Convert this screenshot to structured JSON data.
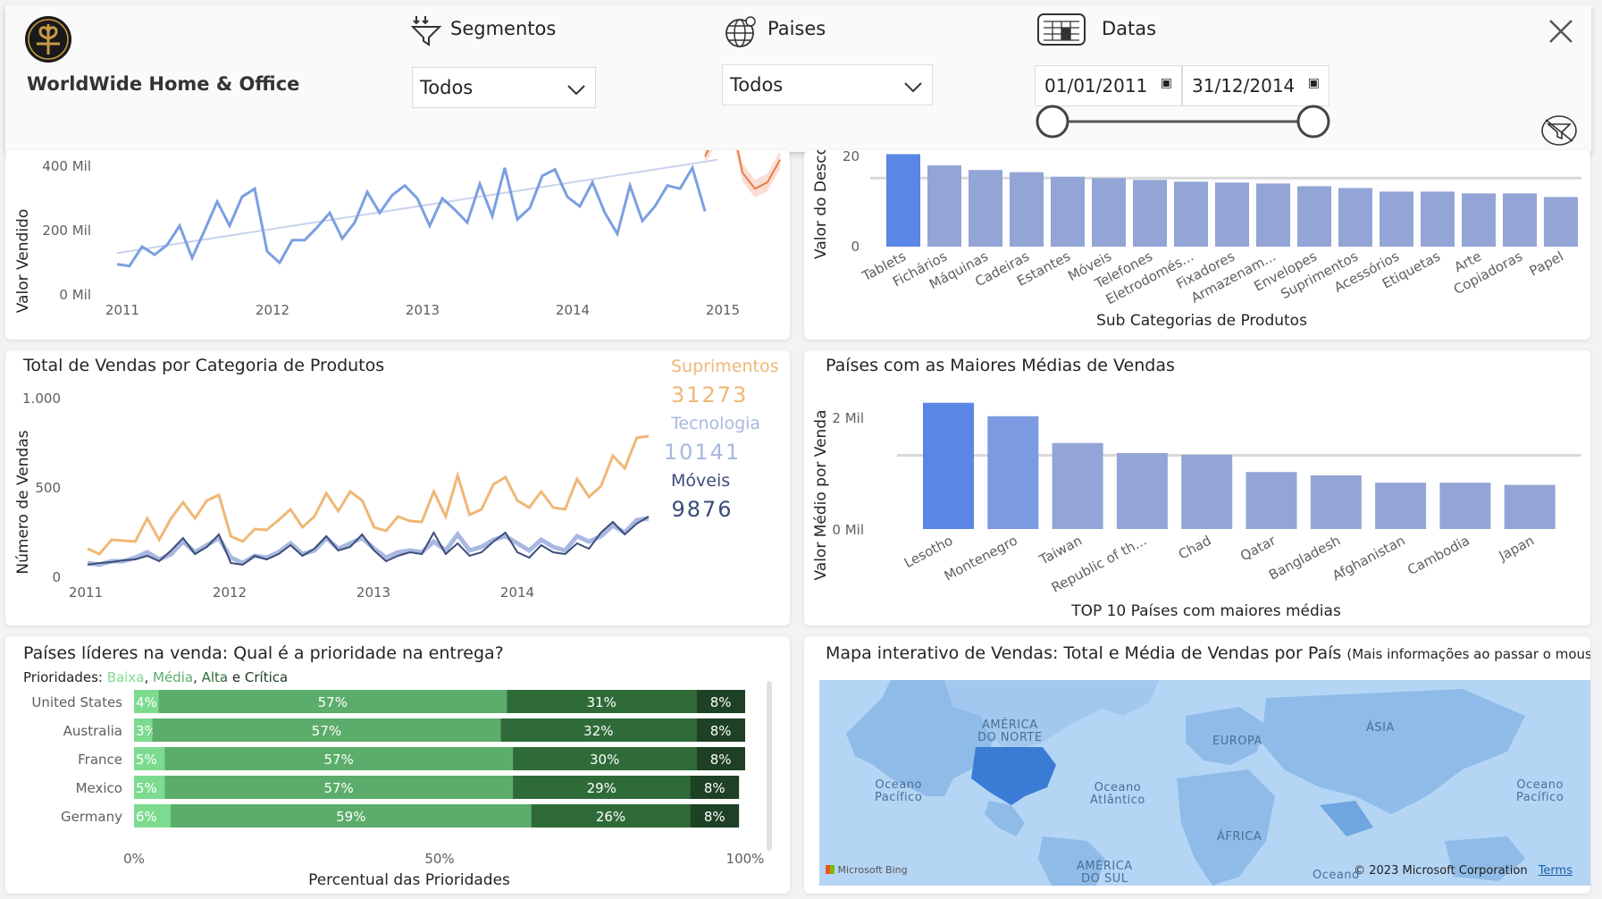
{
  "header": {
    "brand": "WorldWide Home & Office",
    "segment_label": "Segmentos",
    "segment_value": "Todos",
    "country_label": "Paises",
    "country_value": "Todos",
    "dates_label": "Datas",
    "date_start": "01/01/2011",
    "date_end": "31/12/2014"
  },
  "colors": {
    "blue_line": "#7b9fe0",
    "trend": "#c9d3ef",
    "forecast": "#ea7a4a",
    "bar_highlight": "#5a86e6",
    "bar_mid": "#7b9ae0",
    "bar_normal": "#93a5d6",
    "supplies": "#f0b776",
    "tech": "#a9b8e0",
    "furniture": "#3c4d7a",
    "low": "#7cdb8f",
    "medium": "#5cad6b",
    "high": "#2f6b38",
    "critical": "#1e4024"
  },
  "chart_data": [
    {
      "id": "sales-value-timeline",
      "type": "line",
      "ylabel": "Valor Vendido",
      "y_ticks": [
        "400 Mil",
        "200 Mil",
        "0 Mil"
      ],
      "x_ticks": [
        "2011",
        "2012",
        "2013",
        "2014",
        "2015"
      ],
      "ylim": [
        0,
        450
      ],
      "x": [
        2011.0,
        2011.083,
        2011.167,
        2011.25,
        2011.333,
        2011.417,
        2011.5,
        2011.583,
        2011.667,
        2011.75,
        2011.833,
        2011.917,
        2012.0,
        2012.083,
        2012.167,
        2012.25,
        2012.333,
        2012.417,
        2012.5,
        2012.583,
        2012.667,
        2012.75,
        2012.833,
        2012.917,
        2013.0,
        2013.083,
        2013.167,
        2013.25,
        2013.333,
        2013.417,
        2013.5,
        2013.583,
        2013.667,
        2013.75,
        2013.833,
        2013.917,
        2014.0,
        2014.083,
        2014.167,
        2014.25,
        2014.333,
        2014.417,
        2014.5,
        2014.583,
        2014.667,
        2014.75,
        2014.833,
        2014.917
      ],
      "values": [
        95,
        90,
        150,
        125,
        155,
        215,
        115,
        200,
        290,
        215,
        305,
        330,
        135,
        100,
        170,
        170,
        210,
        255,
        175,
        225,
        320,
        255,
        310,
        340,
        300,
        215,
        300,
        265,
        225,
        345,
        245,
        395,
        235,
        270,
        370,
        390,
        305,
        275,
        350,
        255,
        190,
        340,
        230,
        275,
        340,
        330,
        395,
        260
      ],
      "forecast": {
        "x": [
          2014.917,
          2015.0,
          2015.083,
          2015.167,
          2015.25,
          2015.333,
          2015.417
        ],
        "values": [
          430,
          510,
          560,
          380,
          330,
          350,
          420
        ]
      },
      "trend": {
        "x": [
          2011.0,
          2015.0
        ],
        "values": [
          130,
          420
        ]
      }
    },
    {
      "id": "discount-by-subcategory",
      "type": "bar",
      "title": "Sub Categorias de Produtos",
      "ylabel": "Valor do Descor",
      "y_ticks": [
        "20",
        "0"
      ],
      "ylim": [
        0,
        20
      ],
      "categories": [
        "Tablets",
        "Fichários",
        "Máquinas",
        "Cadeiras",
        "Estantes",
        "Móveis",
        "Telefones",
        "Eletrodomés...",
        "Fixadores",
        "Armazenam...",
        "Envelopes",
        "Suprimentos",
        "Acessórios",
        "Etiquetas",
        "Arte",
        "Copiadoras",
        "Papel"
      ],
      "values": [
        20.5,
        18,
        17,
        16.5,
        15.5,
        15.2,
        14.8,
        14.4,
        14.2,
        14.0,
        13.4,
        13.0,
        12.2,
        12.2,
        11.8,
        11.8,
        11.0
      ],
      "average": 15.2
    },
    {
      "id": "sales-by-category",
      "type": "line",
      "title": "Total de Vendas por Categoria de Produtos",
      "ylabel": "Número de Vendas",
      "y_ticks": [
        "1.000",
        "500",
        "0"
      ],
      "x_ticks": [
        "2011",
        "2012",
        "2013",
        "2014"
      ],
      "ylim": [
        0,
        1000
      ],
      "series": [
        {
          "name": "Suprimentos",
          "total": "31273",
          "values": [
            160,
            130,
            210,
            205,
            200,
            330,
            210,
            330,
            420,
            330,
            430,
            460,
            230,
            200,
            270,
            265,
            320,
            380,
            280,
            340,
            470,
            370,
            480,
            430,
            280,
            260,
            340,
            315,
            310,
            480,
            340,
            570,
            350,
            380,
            520,
            560,
            430,
            390,
            480,
            390,
            380,
            550,
            450,
            510,
            680,
            610,
            780,
            790
          ]
        },
        {
          "name": "Tecnologia",
          "total": "10141",
          "values": [
            80,
            70,
            90,
            90,
            110,
            140,
            100,
            130,
            200,
            140,
            180,
            220,
            110,
            80,
            120,
            110,
            140,
            190,
            130,
            150,
            220,
            160,
            190,
            220,
            160,
            110,
            140,
            150,
            140,
            200,
            150,
            240,
            150,
            170,
            210,
            230,
            190,
            150,
            210,
            170,
            150,
            230,
            200,
            230,
            290,
            250,
            320,
            330
          ]
        },
        {
          "name": "Móveis",
          "total": "9876",
          "values": [
            70,
            80,
            85,
            95,
            100,
            120,
            90,
            150,
            220,
            130,
            170,
            240,
            80,
            70,
            120,
            100,
            130,
            180,
            120,
            160,
            230,
            150,
            170,
            240,
            150,
            90,
            120,
            140,
            130,
            250,
            130,
            190,
            120,
            140,
            200,
            250,
            140,
            110,
            180,
            140,
            130,
            190,
            160,
            250,
            310,
            240,
            300,
            340
          ]
        }
      ]
    },
    {
      "id": "top-countries-avg",
      "type": "bar",
      "title": "Países com as Maiores Médias de Vendas",
      "xlabel": "TOP 10 Países com maiores médias",
      "ylabel": "Valor Médio por Venda",
      "y_ticks": [
        "2 Mil",
        "0 Mil"
      ],
      "ylim": [
        0,
        2000
      ],
      "categories": [
        "Lesotho",
        "Montenegro",
        "Taiwan",
        "Republic of th...",
        "Chad",
        "Qatar",
        "Bangladesh",
        "Afghanistan",
        "Cambodia",
        "Japan"
      ],
      "values": [
        2260,
        2020,
        1540,
        1360,
        1330,
        1020,
        960,
        830,
        830,
        790
      ],
      "average": 1320
    },
    {
      "id": "delivery-priority",
      "type": "bar",
      "title": "Países líderes na venda: Qual é a prioridade na entrega?",
      "subtitle_prefix": "Prioridades: ",
      "legend": [
        "Baixa",
        "Média",
        "Alta",
        "Crítica"
      ],
      "legend_sep": [
        ", ",
        ", ",
        " e "
      ],
      "xlabel": "Percentual das Prioridades",
      "x_ticks": [
        "0%",
        "50%",
        "100%"
      ],
      "categories": [
        "United States",
        "Australia",
        "France",
        "Mexico",
        "Germany"
      ],
      "series": [
        {
          "name": "Baixa",
          "values": [
            4,
            3,
            5,
            5,
            6
          ],
          "labels": [
            "4%",
            "3%",
            "5%",
            "5%",
            "6%"
          ]
        },
        {
          "name": "Média",
          "values": [
            57,
            57,
            57,
            57,
            59
          ],
          "labels": [
            "57%",
            "57%",
            "57%",
            "57%",
            "59%"
          ]
        },
        {
          "name": "Alta",
          "values": [
            31,
            32,
            30,
            29,
            26
          ],
          "labels": [
            "31%",
            "32%",
            "30%",
            "29%",
            "26%"
          ]
        },
        {
          "name": "Crítica",
          "values": [
            8,
            8,
            8,
            8,
            8
          ],
          "labels": [
            "8%",
            "8%",
            "8%",
            "8%",
            "8%"
          ]
        }
      ]
    }
  ],
  "map": {
    "title_main": "Mapa interativo de Vendas: Total e Média de Vendas por País",
    "title_note": "(Mais informações ao passar o mouse)",
    "labels": {
      "north_america": "AMÉRICA\nDO NORTE",
      "europe": "EUROPA",
      "asia": "ÁSIA",
      "pacific_w": "Oceano\nPacífico",
      "atlantic": "Oceano\nAtlântico",
      "pacific_e": "Oceano\nPacífico",
      "africa": "ÁFRICA",
      "south_america": "AMÉRICA\nDO SUL",
      "ocean_s": "Oceano"
    },
    "bing": "Microsoft Bing",
    "copyright": "© 2023 Microsoft Corporation",
    "terms": "Terms"
  }
}
